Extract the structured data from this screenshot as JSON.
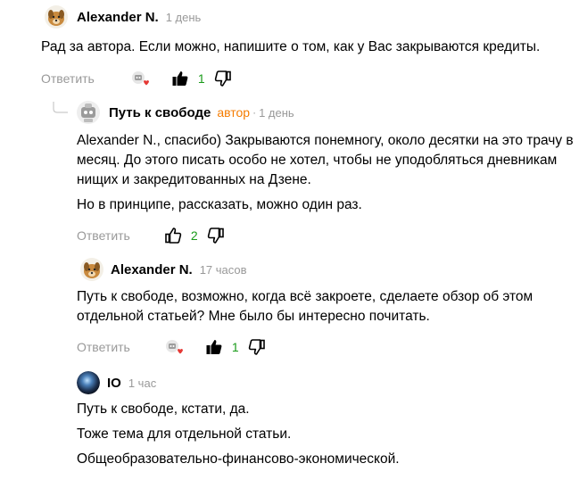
{
  "comments": [
    {
      "author": "Alexander N.",
      "time": "1 день",
      "paragraphs": [
        "Рад за автора. Если можно, напишите о том, как у Вас закрываются кредиты."
      ],
      "reply_label": "Ответить",
      "likes": "1"
    },
    {
      "author": "Путь к свободе",
      "author_tag": "автор",
      "time": "1 день",
      "paragraphs": [
        "Alexander N., спасибо) Закрываются понемногу, около десятки на это трачу в месяц. До этого писать особо не хотел, чтобы не уподобляться дневникам нищих и закредитованных на Дзене.",
        "Но в принципе, рассказать, можно один раз."
      ],
      "reply_label": "Ответить",
      "likes": "2"
    },
    {
      "author": "Alexander N.",
      "time": "17 часов",
      "paragraphs": [
        "Путь к свободе, возможно, когда всё закроете, сделаете обзор об этом отдельной статьей? Мне было бы интересно почитать."
      ],
      "reply_label": "Ответить",
      "likes": "1"
    },
    {
      "author": "IO",
      "time": "1 час",
      "paragraphs": [
        "Путь к свободе, кстати, да.",
        "Тоже тема для отдельной статьи.",
        "Общеобразовательно-финансово-экономической."
      ]
    }
  ],
  "icons": {
    "avatar_dog": "dog-avatar-icon",
    "avatar_author": "robot-avatar-icon",
    "avatar_io": "sphere-avatar-icon",
    "like": "thumbs-up-icon",
    "dislike": "thumbs-down-icon",
    "reactors": "reactors-avatar-icon"
  },
  "colors": {
    "author_tag": "#f57c00",
    "like_count": "#1a9b1a",
    "muted": "#999999"
  }
}
